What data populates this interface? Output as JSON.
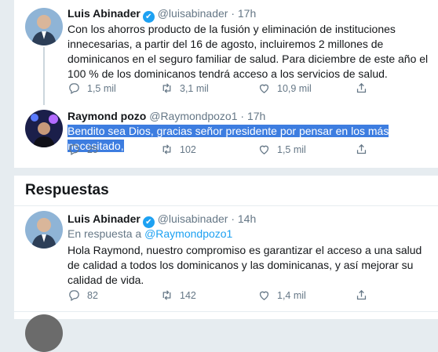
{
  "thread": {
    "main_tweet": {
      "name": "Luis Abinader",
      "handle": "@luisabinader",
      "dot": "·",
      "time": "17h",
      "text": "Con los ahorros producto de la fusión y eliminación de instituciones innecesarias, a partir del 16 de agosto, incluiremos 2 millones de dominicanos en el seguro familiar de salud. Para diciembre de este año el 100 % de los dominicanos tendrá acceso a los servicios de salud.",
      "replies": "1,5 mil",
      "retweets": "3,1 mil",
      "likes": "10,9 mil"
    },
    "reply_tweet": {
      "name": "Raymond pozo",
      "handle": "@Raymondpozo1",
      "dot": "·",
      "time": "17h",
      "text": "Bendito sea Dios, gracias señor presidente por pensar en los más necesitado,",
      "replies": "25",
      "retweets": "102",
      "likes": "1,5 mil"
    }
  },
  "responses": {
    "title": "Respuestas",
    "tweet": {
      "name": "Luis Abinader",
      "handle": "@luisabinader",
      "dot": "·",
      "time": "14h",
      "reply_prefix": "En respuesta a",
      "reply_to": "@Raymondpozo1",
      "text": "Hola Raymond, nuestro compromiso es garantizar el acceso a una salud de calidad a todos los dominicanos y las dominicanas, y así mejorar su calidad de vida.",
      "replies": "82",
      "retweets": "142",
      "likes": "1,4 mil"
    }
  },
  "colors": {
    "accent": "#1da1f2",
    "selection": "#3d7de0",
    "muted": "#657786",
    "background": "#e6ecf0"
  },
  "icons": [
    "reply-icon",
    "retweet-icon",
    "like-icon",
    "share-icon",
    "verified-badge-icon"
  ]
}
